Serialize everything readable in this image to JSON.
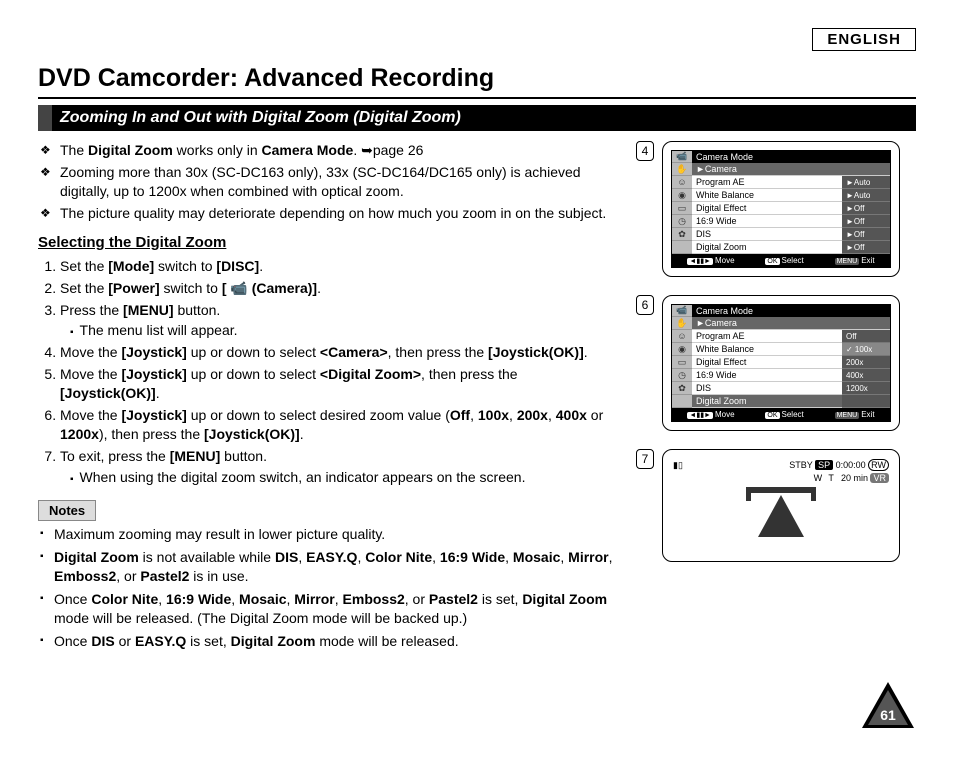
{
  "language_label": "ENGLISH",
  "page_title": "DVD Camcorder: Advanced Recording",
  "section_heading": "Zooming In and Out with Digital Zoom (Digital Zoom)",
  "page_number": "61",
  "bullets": [
    {
      "pre": "The ",
      "b1": "Digital Zoom",
      "mid": " works only in ",
      "b2": "Camera Mode",
      "post": ". ➥page 26"
    },
    {
      "full": "Zooming more than 30x (SC-DC163 only), 33x (SC-DC164/DC165 only) is achieved digitally, up to 1200x when combined with optical zoom."
    },
    {
      "full": "The picture quality may deteriorate depending on how much you zoom in on the subject."
    }
  ],
  "subsection_heading": "Selecting the Digital Zoom",
  "steps": {
    "s1": {
      "pre": "Set the ",
      "b1": "[Mode]",
      "mid": " switch to ",
      "b2": "[DISC]",
      "post": "."
    },
    "s2": {
      "pre": "Set the ",
      "b1": "[Power]",
      "mid": " switch to ",
      "b2": "[ 📹 (Camera)]",
      "post": "."
    },
    "s3": {
      "pre": "Press the ",
      "b1": "[MENU]",
      "post": " button.",
      "sub": "The menu list will appear."
    },
    "s4": {
      "pre": "Move the ",
      "b1": "[Joystick]",
      "mid": " up or down to select ",
      "b2": "<Camera>",
      "mid2": ", then press the ",
      "b3": "[Joystick(OK)]",
      "post": "."
    },
    "s5": {
      "pre": "Move the ",
      "b1": "[Joystick]",
      "mid": " up or down to select ",
      "b2": "<Digital Zoom>",
      "mid2": ", then press the ",
      "b3": "[Joystick(OK)]",
      "post": "."
    },
    "s6": {
      "pre": "Move the ",
      "b1": "[Joystick]",
      "mid": " up or down to select desired zoom value (",
      "v1": "Off",
      "c": ", ",
      "v2": "100x",
      "v3": "200x",
      "v4": "400x",
      "or": " or ",
      "v5": "1200x",
      "mid2": "), then press the ",
      "b3": "[Joystick(OK)]",
      "post": "."
    },
    "s7": {
      "pre": "To exit, press the ",
      "b1": "[MENU]",
      "post": " button.",
      "sub": "When using the digital zoom switch, an indicator appears on the screen."
    }
  },
  "notes_label": "Notes",
  "notes": {
    "n1": "Maximum zooming may result in lower picture quality.",
    "n2": {
      "b1": "Digital Zoom",
      "t1": " is not available while ",
      "l": [
        "DIS",
        "EASY.Q",
        "Color Nite",
        "16:9 Wide",
        "Mosaic",
        "Mirror",
        "Emboss2"
      ],
      "or": ", or ",
      "last": "Pastel2",
      "post": " is in use."
    },
    "n3": {
      "t1": "Once ",
      "l": [
        "Color Nite",
        "16:9 Wide",
        "Mosaic",
        "Mirror",
        "Emboss2"
      ],
      "or": ", or ",
      "last": "Pastel2",
      "t2": " is set, ",
      "b1": "Digital Zoom",
      "post": " mode will be released. (The Digital Zoom mode will be backed up.)"
    },
    "n4": {
      "t1": "Once ",
      "b1": "DIS",
      "or": " or ",
      "b2": "EASY.Q",
      "t2": " is set, ",
      "b3": "Digital Zoom",
      "post": " mode will be released."
    }
  },
  "figures": {
    "f4": {
      "num": "4",
      "top": "Camera Mode",
      "selected": "►Camera",
      "rows": [
        {
          "label": "Program AE",
          "val": "►Auto"
        },
        {
          "label": "White Balance",
          "val": "►Auto"
        },
        {
          "label": "Digital Effect",
          "val": "►Off"
        },
        {
          "label": "16:9 Wide",
          "val": "►Off"
        },
        {
          "label": "DIS",
          "val": "►Off"
        },
        {
          "label": "Digital Zoom",
          "val": "►Off"
        }
      ],
      "foot": {
        "move": "Move",
        "select": "Select",
        "exit": "Exit",
        "ok": "OK",
        "menu": "MENU",
        "arrows": "◄▮▮►"
      }
    },
    "f6": {
      "num": "6",
      "top": "Camera Mode",
      "selected": "►Camera",
      "rows": [
        {
          "label": "Program AE",
          "val": "Off"
        },
        {
          "label": "White Balance",
          "val": "✓ 100x",
          "hi": true
        },
        {
          "label": "Digital Effect",
          "val": "200x"
        },
        {
          "label": "16:9 Wide",
          "val": "400x"
        },
        {
          "label": "DIS",
          "val": "1200x"
        },
        {
          "label": "Digital Zoom",
          "val": ""
        }
      ],
      "foot": {
        "move": "Move",
        "select": "Select",
        "exit": "Exit",
        "ok": "OK",
        "menu": "MENU",
        "arrows": "◄▮▮►"
      }
    },
    "f7": {
      "num": "7",
      "stby": "STBY",
      "sp": "SP",
      "time": "0:00:00",
      "rw": "RW",
      "remain": "20 min",
      "vr": "VR",
      "wt": "W                    T"
    }
  }
}
